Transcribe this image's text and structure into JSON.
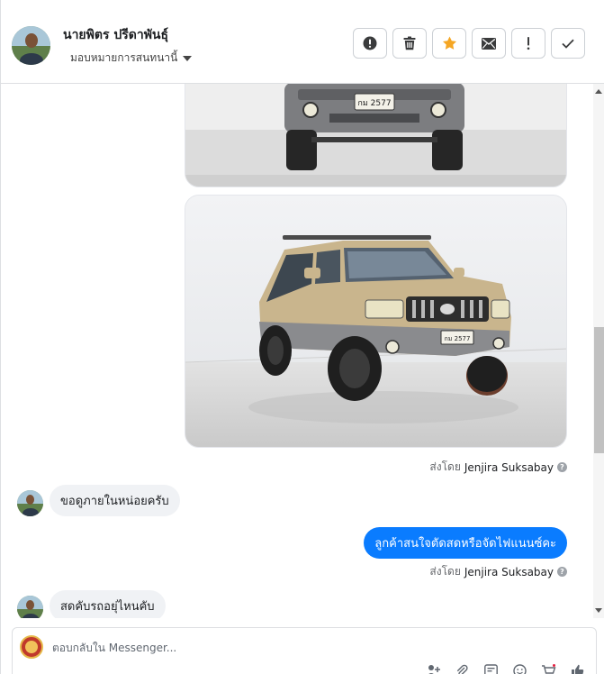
{
  "header": {
    "contact_name": "นายพิตร ปรีดาพันธุ์",
    "assign_label": "มอบหมายการสนทนานี้"
  },
  "actions": [
    {
      "name": "report-spam-button",
      "icon": "alert-circle-icon"
    },
    {
      "name": "delete-button",
      "icon": "trash-icon"
    },
    {
      "name": "star-button",
      "icon": "star-icon"
    },
    {
      "name": "mark-unread-button",
      "icon": "envelope-icon"
    },
    {
      "name": "mark-important-button",
      "icon": "exclamation-icon"
    },
    {
      "name": "mark-done-button",
      "icon": "check-icon"
    }
  ],
  "colors": {
    "accent_star": "#f5a623",
    "outgoing_bubble": "#0a7cff",
    "incoming_bubble": "#f0f2f5"
  },
  "images": [
    {
      "plate": "กม 2577"
    },
    {
      "plate": "กม 2577"
    }
  ],
  "messages": {
    "sent_by_prefix": "ส่งโดย",
    "sent_by_1": "Jenjira Suksabay",
    "incoming_1": "ขอดูภายในหน่อยครับ",
    "outgoing_1": "ลูกค้าสนใจตัดสดหรือจัดไฟแนนซ์คะ",
    "sent_by_2": "Jenjira Suksabay",
    "incoming_2": "สดคับรถอยุ่ไหนคับ"
  },
  "composer": {
    "placeholder": "ตอบกลับใน Messenger..."
  }
}
